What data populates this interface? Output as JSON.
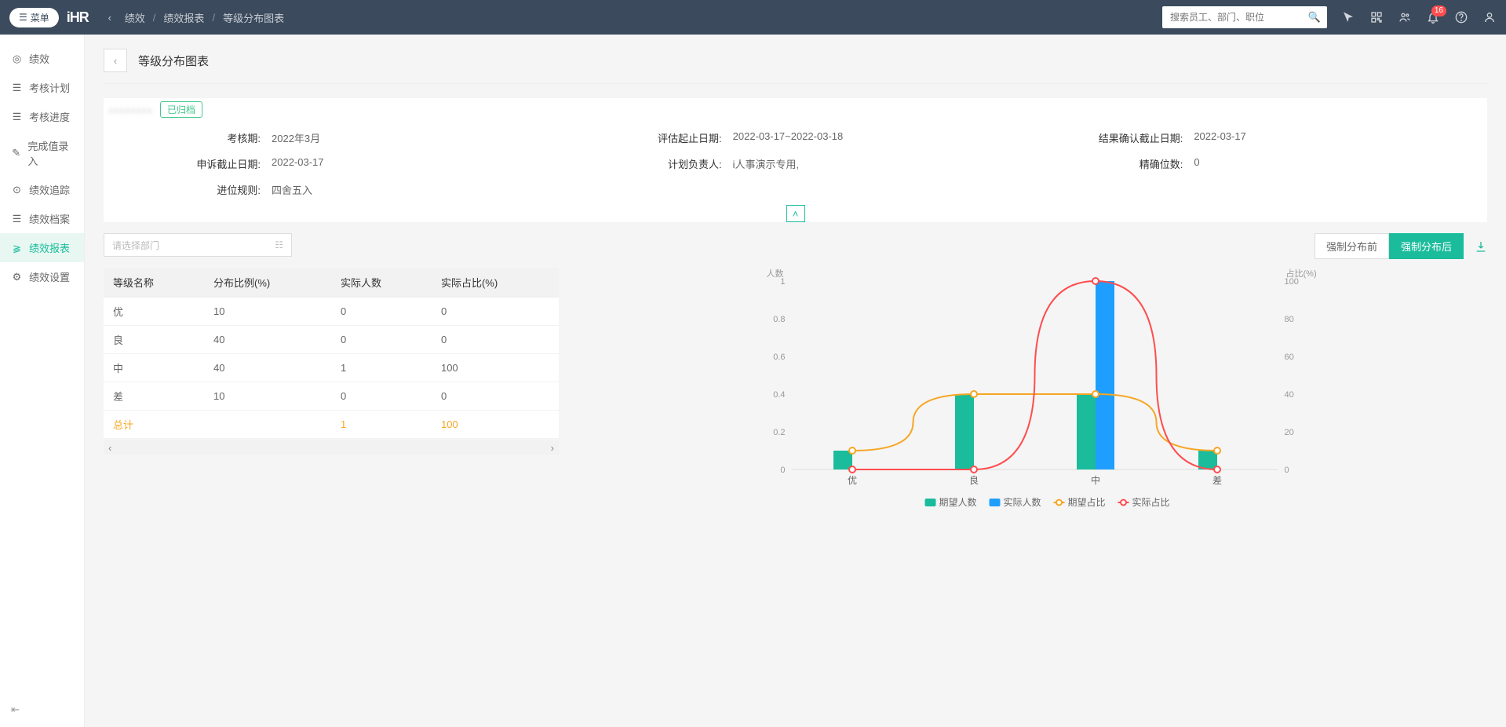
{
  "topbar": {
    "menu_label": "菜单",
    "logo": "iHR",
    "breadcrumb": [
      "绩效",
      "绩效报表",
      "等级分布图表"
    ],
    "search_placeholder": "搜索员工、部门、职位",
    "notif_count": "16"
  },
  "sidebar": {
    "items": [
      {
        "label": "绩效"
      },
      {
        "label": "考核计划"
      },
      {
        "label": "考核进度"
      },
      {
        "label": "完成值录入"
      },
      {
        "label": "绩效追踪"
      },
      {
        "label": "绩效档案"
      },
      {
        "label": "绩效报表"
      },
      {
        "label": "绩效设置"
      }
    ]
  },
  "page": {
    "title": "等级分布图表",
    "plan_name_masked": "xxxxxxxx",
    "status_badge": "已归档"
  },
  "info": {
    "period_lbl": "考核期:",
    "period": "2022年3月",
    "eval_range_lbl": "评估起止日期:",
    "eval_range": "2022-03-17~2022-03-18",
    "confirm_due_lbl": "结果确认截止日期:",
    "confirm_due": "2022-03-17",
    "appeal_due_lbl": "申诉截止日期:",
    "appeal_due": "2022-03-17",
    "owner_lbl": "计划负责人:",
    "owner": "i人事演示专用,",
    "precision_lbl": "精确位数:",
    "precision": "0",
    "round_lbl": "进位规则:",
    "round": "四舍五入"
  },
  "dept_placeholder": "请选择部门",
  "table": {
    "headers": [
      "等级名称",
      "分布比例(%)",
      "实际人数",
      "实际占比(%)"
    ],
    "rows": [
      {
        "name": "优",
        "pct": "10",
        "cnt": "0",
        "ratio": "0"
      },
      {
        "name": "良",
        "pct": "40",
        "cnt": "0",
        "ratio": "0"
      },
      {
        "name": "中",
        "pct": "40",
        "cnt": "1",
        "ratio": "100"
      },
      {
        "name": "差",
        "pct": "10",
        "cnt": "0",
        "ratio": "0"
      }
    ],
    "total": {
      "name": "总计",
      "cnt": "1",
      "ratio": "100"
    }
  },
  "buttons": {
    "before": "强制分布前",
    "after": "强制分布后"
  },
  "chart_data": {
    "type": "bar+line",
    "title_left": "人数",
    "title_right": "占比(%)",
    "categories": [
      "优",
      "良",
      "中",
      "差"
    ],
    "y_left": {
      "min": 0,
      "max": 1,
      "ticks": [
        0,
        0.2,
        0.4,
        0.6,
        0.8,
        1
      ]
    },
    "y_right": {
      "min": 0,
      "max": 100,
      "ticks": [
        0,
        20,
        40,
        60,
        80,
        100
      ]
    },
    "series": [
      {
        "name": "期望人数",
        "type": "bar",
        "axis": "left",
        "color": "#1abc9c",
        "values": [
          0.1,
          0.4,
          0.4,
          0.1
        ]
      },
      {
        "name": "实际人数",
        "type": "bar",
        "axis": "left",
        "color": "#1e9fff",
        "values": [
          0,
          0,
          1,
          0
        ]
      },
      {
        "name": "期望占比",
        "type": "line",
        "axis": "right",
        "color": "#f6a623",
        "values": [
          10,
          40,
          40,
          10
        ]
      },
      {
        "name": "实际占比",
        "type": "line",
        "axis": "right",
        "color": "#ff4d4f",
        "values": [
          0,
          0,
          100,
          0
        ]
      }
    ]
  }
}
